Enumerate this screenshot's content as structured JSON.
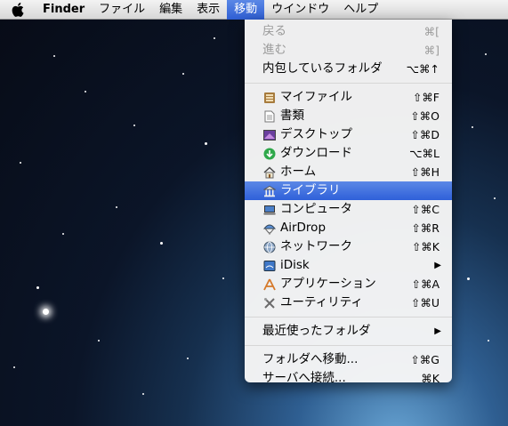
{
  "menubar": {
    "items": [
      {
        "label": "Finder"
      },
      {
        "label": "ファイル"
      },
      {
        "label": "編集"
      },
      {
        "label": "表示"
      },
      {
        "label": "移動"
      },
      {
        "label": "ウインドウ"
      },
      {
        "label": "ヘルプ"
      }
    ],
    "active_item": "移動"
  },
  "go_menu": {
    "group1": [
      {
        "label": "戻る",
        "shortcut": "⌘[",
        "enabled": false
      },
      {
        "label": "進む",
        "shortcut": "⌘]",
        "enabled": false
      },
      {
        "label": "内包しているフォルダ",
        "shortcut": "⌥⌘↑",
        "enabled": true
      }
    ],
    "group2": [
      {
        "label": "マイファイル",
        "shortcut": "⇧⌘F",
        "icon": "all-my-files-icon"
      },
      {
        "label": "書類",
        "shortcut": "⇧⌘O",
        "icon": "documents-icon"
      },
      {
        "label": "デスクトップ",
        "shortcut": "⇧⌘D",
        "icon": "desktop-icon"
      },
      {
        "label": "ダウンロード",
        "shortcut": "⌥⌘L",
        "icon": "downloads-icon"
      },
      {
        "label": "ホーム",
        "shortcut": "⇧⌘H",
        "icon": "home-icon"
      },
      {
        "label": "ライブラリ",
        "shortcut": "",
        "icon": "library-icon",
        "highlighted": true
      },
      {
        "label": "コンピュータ",
        "shortcut": "⇧⌘C",
        "icon": "computer-icon"
      },
      {
        "label": "AirDrop",
        "shortcut": "⇧⌘R",
        "icon": "airdrop-icon"
      },
      {
        "label": "ネットワーク",
        "shortcut": "⇧⌘K",
        "icon": "network-icon"
      },
      {
        "label": "iDisk",
        "shortcut": "",
        "icon": "idisk-icon",
        "submenu": true
      },
      {
        "label": "アプリケーション",
        "shortcut": "⇧⌘A",
        "icon": "applications-icon"
      },
      {
        "label": "ユーティリティ",
        "shortcut": "⇧⌘U",
        "icon": "utilities-icon"
      }
    ],
    "group3": [
      {
        "label": "最近使ったフォルダ",
        "submenu": true
      }
    ],
    "group4": [
      {
        "label": "フォルダへ移動...",
        "shortcut": "⇧⌘G"
      },
      {
        "label": "サーバへ接続...",
        "shortcut": "⌘K"
      }
    ]
  },
  "colors": {
    "highlight": "#3a67dc",
    "menu_bg": "#f6f6f6",
    "disabled_text": "#9a9a9a"
  }
}
